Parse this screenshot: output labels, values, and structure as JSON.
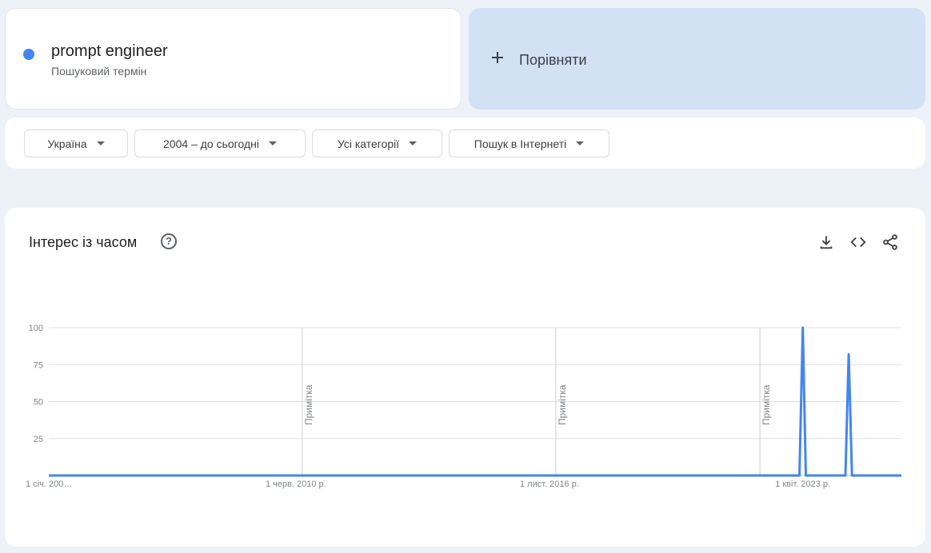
{
  "search_term": {
    "name": "prompt engineer",
    "subtitle": "Пошуковий термін",
    "color": "#4285f4"
  },
  "compare": {
    "label": "Порівняти"
  },
  "filters": {
    "region": "Україна",
    "period": "2004 – до сьогодні",
    "category": "Усі категорії",
    "search_type": "Пошук в Інтернеті"
  },
  "chart_section": {
    "title": "Інтерес із часом",
    "icons": [
      "help-icon",
      "download-icon",
      "embed-icon",
      "share-icon"
    ]
  },
  "chart_data": {
    "type": "line",
    "title": "",
    "xlabel": "",
    "ylabel": "",
    "ylim": [
      0,
      100
    ],
    "y_ticks": [
      25,
      50,
      75,
      100
    ],
    "grid": true,
    "x_range": [
      "2004-01-01",
      "2025-08-01"
    ],
    "x_tick_labels": [
      {
        "date": "2004-01-01",
        "label": "1 січ. 200…"
      },
      {
        "date": "2010-06-01",
        "label": "1 черв. 2010 р."
      },
      {
        "date": "2016-11-01",
        "label": "1 лист. 2016 р."
      },
      {
        "date": "2023-04-01",
        "label": "1 квіт. 2023 р."
      }
    ],
    "annotations": [
      {
        "date": "2010-06-01",
        "label": "Примітка"
      },
      {
        "date": "2016-11-01",
        "label": "Примітка"
      },
      {
        "date": "2022-01-01",
        "label": "Примітка"
      }
    ],
    "series": [
      {
        "name": "prompt engineer",
        "color": "#4285f4",
        "points": [
          {
            "x": "2004-01-01",
            "y": 0
          },
          {
            "x": "2023-01-01",
            "y": 0
          },
          {
            "x": "2023-02-01",
            "y": 100
          },
          {
            "x": "2023-03-01",
            "y": 0
          },
          {
            "x": "2024-03-01",
            "y": 0
          },
          {
            "x": "2024-04-01",
            "y": 82
          },
          {
            "x": "2024-05-01",
            "y": 0
          },
          {
            "x": "2025-08-01",
            "y": 0
          }
        ]
      }
    ]
  }
}
